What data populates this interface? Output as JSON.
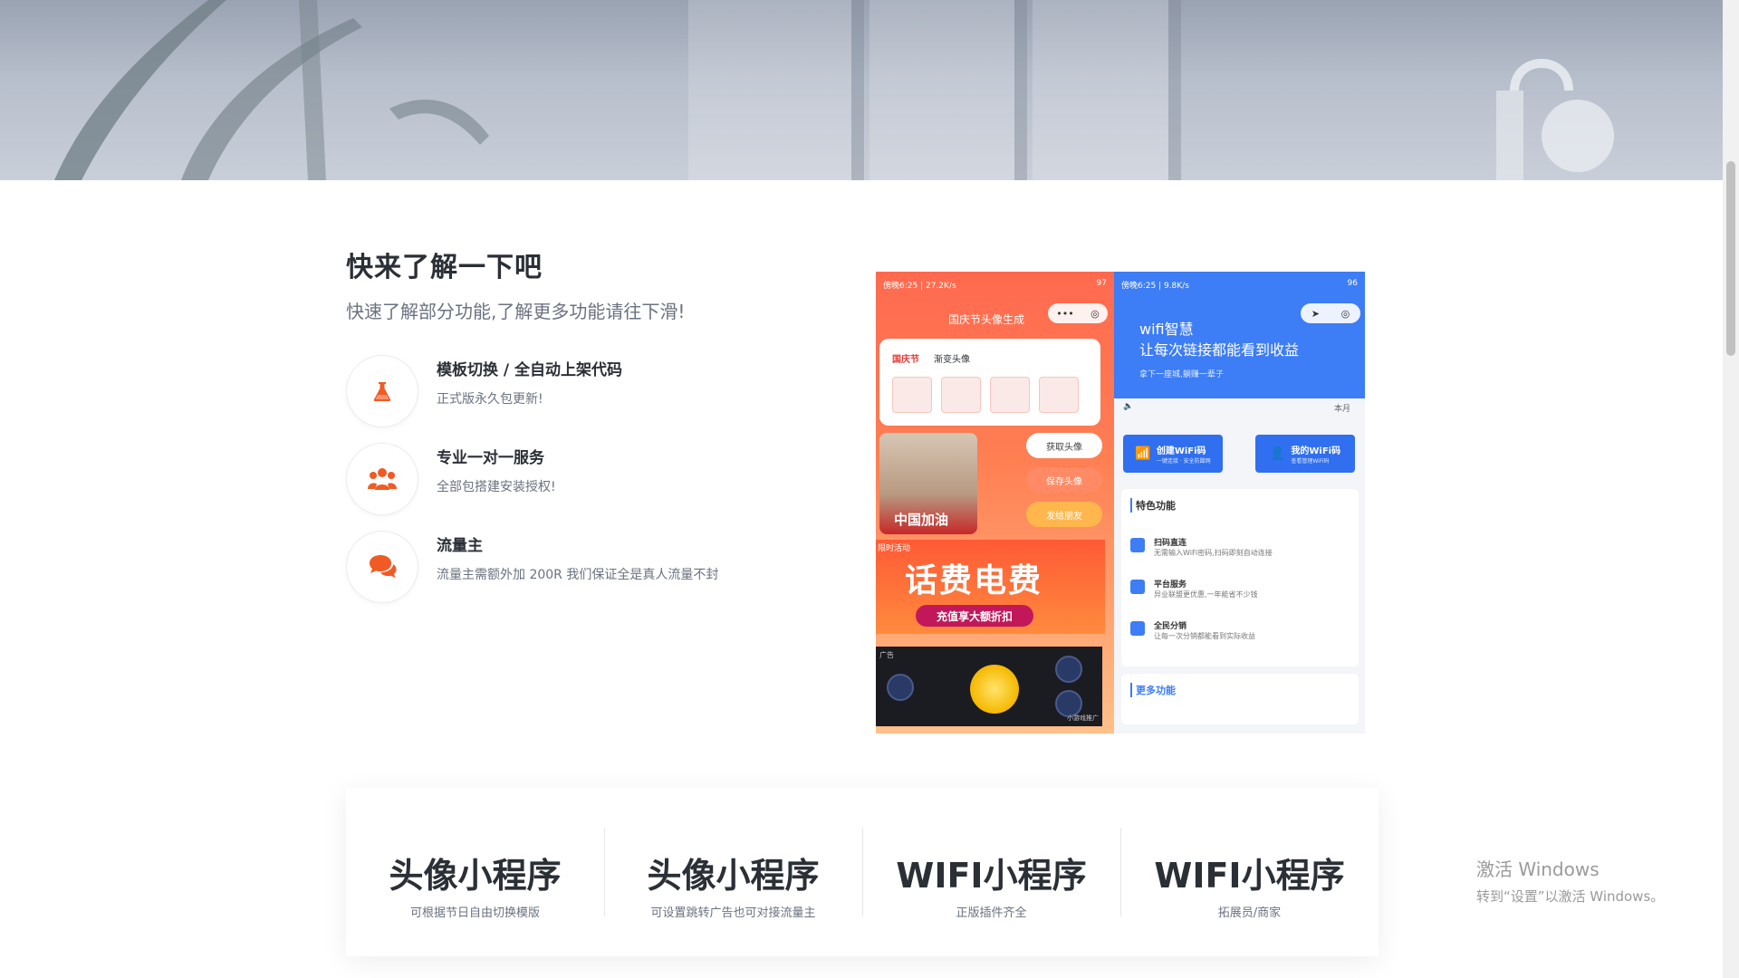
{
  "intro": {
    "title": "快来了解一下吧",
    "subtitle": "快速了解部分功能,了解更多功能请往下滑!"
  },
  "features": [
    {
      "icon": "flask-icon",
      "title": "模板切换 / 全自动上架代码",
      "desc": "正式版永久包更新!"
    },
    {
      "icon": "users-icon",
      "title": "专业一对一服务",
      "desc": "全部包搭建安装授权!"
    },
    {
      "icon": "chat-icon",
      "title": "流量主",
      "desc": "流量主需额外加 200R 我们保证全是真人流量不封"
    }
  ],
  "mockup": {
    "left": {
      "status_left": "傍晚6:25 | 27.2K/s",
      "status_right": "97",
      "title": "国庆节头像生成",
      "capsule_more": "•••",
      "capsule_close": "◎",
      "tabs": [
        "国庆节",
        "渐变头像"
      ],
      "photo_label": "中国加油",
      "btn_get": "获取头像",
      "btn_save": "保存头像",
      "btn_share": "发给朋友",
      "banner_tag": "限时活动",
      "banner_big": "话费电费",
      "banner_pill": "充值享大额折扣",
      "game_ad": "广告",
      "game_note": "小游戏推广"
    },
    "right": {
      "status_left": "傍晚6:25 | 9.8K/s",
      "status_right": "96",
      "capsule_nav": "➤",
      "capsule_close": "◎",
      "headline1": "wifi智慧",
      "headline2": "让每次链接都能看到收益",
      "headline3": "拿下一座城,躺赚一辈子",
      "bar_right": "本月",
      "btn_create": "创建WiFi码",
      "btn_create_sub": "一键连接 · 安全防蹭网",
      "btn_mine": "我的WiFi码",
      "btn_mine_sub": "查看管理WiFi码",
      "section_title": "特色功能",
      "items": [
        {
          "name": "扫码直连",
          "desc": "无需输入WiFi密码,扫码即刻自动连接"
        },
        {
          "name": "平台服务",
          "desc": "异业联盟更优惠,一年能省不少钱"
        },
        {
          "name": "全民分销",
          "desc": "让每一次分销都能看到实际收益"
        }
      ],
      "more": "更多功能"
    }
  },
  "stats": [
    {
      "big": "头像小程序",
      "small": "可根据节日自由切换模版"
    },
    {
      "big": "头像小程序",
      "small": "可设置跳转广告也可对接流量主"
    },
    {
      "big": "WIFI小程序",
      "small": "正版插件齐全"
    },
    {
      "big": "WIFI小程序",
      "small": "拓展员/商家"
    }
  ],
  "watermark": {
    "line1": "激活 Windows",
    "line2": "转到“设置”以激活 Windows。"
  },
  "colors": {
    "accent": "#f05a24",
    "text": "#2b2f36",
    "muted": "#6b7280",
    "wifi_blue": "#3d7df5"
  }
}
